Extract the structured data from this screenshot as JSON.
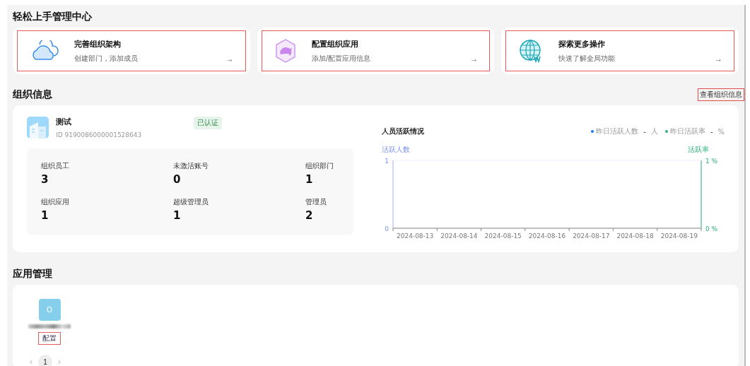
{
  "quick_start": {
    "title": "轻松上手管理中心",
    "cards": [
      {
        "kind": "cloud",
        "title": "完善组织架构",
        "subtitle": "创建部门，添加成员",
        "arrow": "→"
      },
      {
        "kind": "dolphin",
        "title": "配置组织应用",
        "subtitle": "添加/配置应用信息",
        "arrow": "→"
      },
      {
        "kind": "globe",
        "title": "探索更多操作",
        "subtitle": "快速了解全局功能",
        "arrow": "→"
      }
    ]
  },
  "org_info": {
    "title": "组织信息",
    "link": "查看组织信息",
    "org": {
      "name": "测试",
      "badge": "已认证",
      "id": "ID 9190086000001528643"
    },
    "stats": [
      {
        "label": "组织员工",
        "value": "3"
      },
      {
        "label": "未激活账号",
        "value": "0"
      },
      {
        "label": "组织部门",
        "value": "1"
      },
      {
        "label": "组织应用",
        "value": "1"
      },
      {
        "label": "超级管理员",
        "value": "1"
      },
      {
        "label": "管理员",
        "value": "2"
      }
    ],
    "activity": {
      "title": "人员活跃情况",
      "legend": [
        {
          "value": "-",
          "unit": "人"
        },
        {
          "value": "-",
          "unit": "%"
        }
      ],
      "chart_data": {
        "type": "line",
        "ylabel": "活跃人数",
        "y2label": "活跃率",
        "categories": [
          "2024-08-13",
          "2024-08-14",
          "2024-08-15",
          "2024-08-16",
          "2024-08-17",
          "2024-08-18",
          "2024-08-19"
        ],
        "series": [
          {
            "name": "昨日活跃人数",
            "color": "#1677ff",
            "values": [
              null,
              null,
              null,
              null,
              null,
              null,
              null
            ]
          },
          {
            "name": "昨日活跃率",
            "color": "#2db37a",
            "values": [
              null,
              null,
              null,
              null,
              null,
              null,
              null
            ]
          }
        ],
        "ylim": [
          0,
          1
        ],
        "yticks": [
          0,
          1
        ],
        "y2lim": [
          0,
          1
        ],
        "y2ticks": [
          {
            "value": 0,
            "label": "0 %"
          },
          {
            "value": 1,
            "label": "1 %"
          }
        ]
      }
    }
  },
  "app_management": {
    "title": "应用管理",
    "apps": [
      {
        "initial": "O",
        "action": "配置"
      }
    ],
    "pagination": {
      "prev": "‹",
      "pages": [
        {
          "label": "1",
          "selected": true
        }
      ],
      "next": "›"
    }
  }
}
